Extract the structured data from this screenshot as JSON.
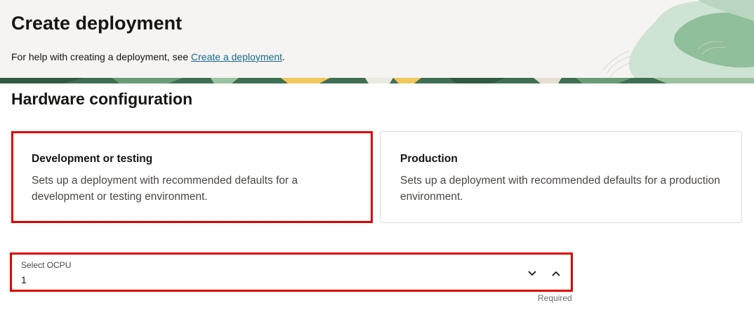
{
  "header": {
    "title": "Create deployment",
    "help_text": "For help with creating a deployment, see ",
    "help_link": "Create a deployment",
    "help_end": "."
  },
  "hardware": {
    "title": "Hardware configuration",
    "options": [
      {
        "title": "Development or testing",
        "description": "Sets up a deployment with recommended defaults for a development or testing environment."
      },
      {
        "title": "Production",
        "description": "Sets up a deployment with recommended defaults for a production environment."
      }
    ]
  },
  "ocpu": {
    "label": "Select OCPU",
    "value": "1",
    "required": "Required"
  },
  "colors": {
    "highlight": "#e00000",
    "link": "#1a6b8c",
    "header_bg": "#f5f4f2"
  }
}
